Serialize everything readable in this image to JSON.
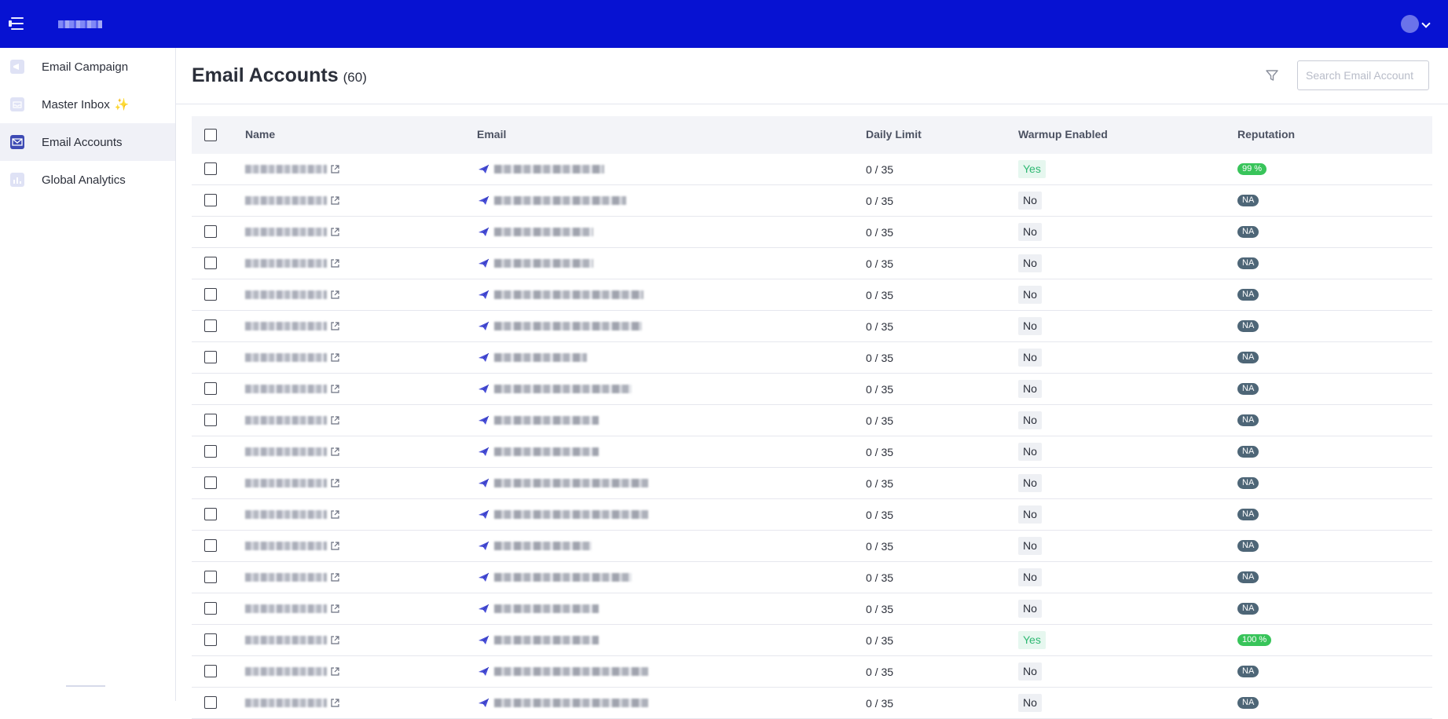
{
  "header": {
    "menu_icon": "menu-collapse-icon",
    "avatar_icon": "user-avatar",
    "colors": {
      "topbar": "#0712d2",
      "accent": "#3d4ab4"
    }
  },
  "sidebar": {
    "items": [
      {
        "label": "Email Campaign",
        "icon": "campaign-icon",
        "active": false
      },
      {
        "label": "Master Inbox",
        "icon": "inbox-icon",
        "active": false,
        "badge_icon": "sparkle-icon"
      },
      {
        "label": "Email Accounts",
        "icon": "email-icon",
        "active": true
      },
      {
        "label": "Global Analytics",
        "icon": "analytics-icon",
        "active": false
      }
    ]
  },
  "page": {
    "title": "Email Accounts",
    "count": "(60)",
    "search_placeholder": "Search Email Account",
    "filter_icon": "filter-icon"
  },
  "table": {
    "columns": [
      "Name",
      "Email",
      "Daily Limit",
      "Warmup Enabled",
      "Reputation"
    ],
    "rows": [
      {
        "daily_limit": "0 / 35",
        "warmup": "Yes",
        "reputation": "99 %"
      },
      {
        "daily_limit": "0 / 35",
        "warmup": "No",
        "reputation": "NA"
      },
      {
        "daily_limit": "0 / 35",
        "warmup": "No",
        "reputation": "NA"
      },
      {
        "daily_limit": "0 / 35",
        "warmup": "No",
        "reputation": "NA"
      },
      {
        "daily_limit": "0 / 35",
        "warmup": "No",
        "reputation": "NA"
      },
      {
        "daily_limit": "0 / 35",
        "warmup": "No",
        "reputation": "NA"
      },
      {
        "daily_limit": "0 / 35",
        "warmup": "No",
        "reputation": "NA"
      },
      {
        "daily_limit": "0 / 35",
        "warmup": "No",
        "reputation": "NA"
      },
      {
        "daily_limit": "0 / 35",
        "warmup": "No",
        "reputation": "NA"
      },
      {
        "daily_limit": "0 / 35",
        "warmup": "No",
        "reputation": "NA"
      },
      {
        "daily_limit": "0 / 35",
        "warmup": "No",
        "reputation": "NA"
      },
      {
        "daily_limit": "0 / 35",
        "warmup": "No",
        "reputation": "NA"
      },
      {
        "daily_limit": "0 / 35",
        "warmup": "No",
        "reputation": "NA"
      },
      {
        "daily_limit": "0 / 35",
        "warmup": "No",
        "reputation": "NA"
      },
      {
        "daily_limit": "0 / 35",
        "warmup": "No",
        "reputation": "NA"
      },
      {
        "daily_limit": "0 / 35",
        "warmup": "Yes",
        "reputation": "100 %"
      },
      {
        "daily_limit": "0 / 35",
        "warmup": "No",
        "reputation": "NA"
      },
      {
        "daily_limit": "0 / 35",
        "warmup": "No",
        "reputation": "NA"
      }
    ]
  }
}
